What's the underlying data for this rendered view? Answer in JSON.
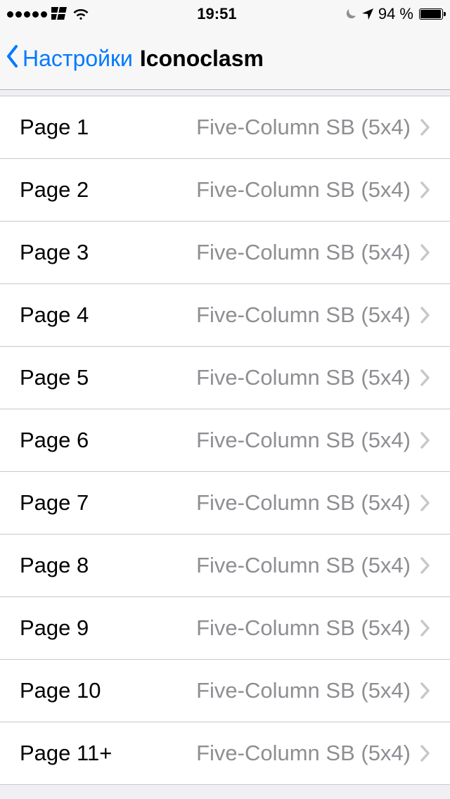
{
  "status_bar": {
    "time": "19:51",
    "battery_percent": "94 %"
  },
  "nav": {
    "back_label": "Настройки",
    "title": "Iconoclasm"
  },
  "rows": [
    {
      "label": "Page 1",
      "detail": "Five-Column SB (5x4)"
    },
    {
      "label": "Page 2",
      "detail": "Five-Column SB (5x4)"
    },
    {
      "label": "Page 3",
      "detail": "Five-Column SB (5x4)"
    },
    {
      "label": "Page 4",
      "detail": "Five-Column SB (5x4)"
    },
    {
      "label": "Page 5",
      "detail": "Five-Column SB (5x4)"
    },
    {
      "label": "Page 6",
      "detail": "Five-Column SB (5x4)"
    },
    {
      "label": "Page 7",
      "detail": "Five-Column SB (5x4)"
    },
    {
      "label": "Page 8",
      "detail": "Five-Column SB (5x4)"
    },
    {
      "label": "Page 9",
      "detail": "Five-Column SB (5x4)"
    },
    {
      "label": "Page 10",
      "detail": "Five-Column SB (5x4)"
    },
    {
      "label": "Page 11+",
      "detail": "Five-Column SB (5x4)"
    }
  ]
}
